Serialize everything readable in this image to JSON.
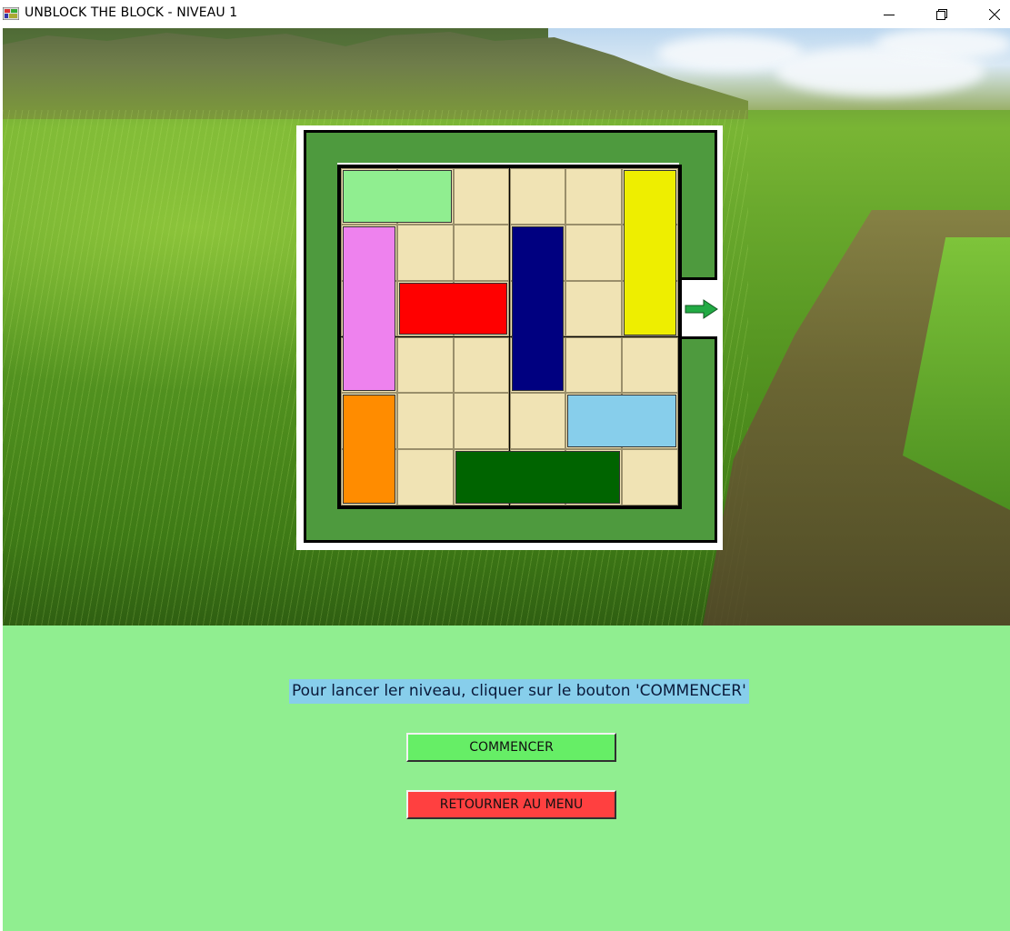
{
  "window": {
    "title": "UNBLOCK THE BLOCK - NIVEAU 1",
    "controls": [
      "minimize-icon",
      "restore-icon",
      "close-icon"
    ]
  },
  "board": {
    "rows": 6,
    "cols": 6,
    "exit_row": 2,
    "exit_side": "right",
    "exit_arrow_color": "#22aa44",
    "border_color": "#4e9a3e",
    "cell_color": "#f0e3b4",
    "blocks": [
      {
        "id": "light-green-block",
        "color": "#90ee90",
        "row": 0,
        "col": 0,
        "length": 2,
        "orientation": "horizontal"
      },
      {
        "id": "yellow-block",
        "color": "#eeee00",
        "row": 0,
        "col": 5,
        "length": 3,
        "orientation": "vertical"
      },
      {
        "id": "violet-block",
        "color": "#ee82ee",
        "row": 1,
        "col": 0,
        "length": 3,
        "orientation": "vertical"
      },
      {
        "id": "navy-block",
        "color": "#000080",
        "row": 1,
        "col": 3,
        "length": 3,
        "orientation": "vertical"
      },
      {
        "id": "red-target-block",
        "color": "#ff0000",
        "row": 2,
        "col": 1,
        "length": 2,
        "orientation": "horizontal"
      },
      {
        "id": "orange-block",
        "color": "#ff8c00",
        "row": 4,
        "col": 0,
        "length": 2,
        "orientation": "vertical"
      },
      {
        "id": "sky-blue-block",
        "color": "#87ceeb",
        "row": 4,
        "col": 4,
        "length": 2,
        "orientation": "horizontal"
      },
      {
        "id": "dark-green-block",
        "color": "#006400",
        "row": 5,
        "col": 2,
        "length": 3,
        "orientation": "horizontal"
      }
    ]
  },
  "panel": {
    "instruction": "Pour lancer ler niveau, cliquer sur le bouton 'COMMENCER'",
    "start_label": "COMMENCER",
    "menu_label": "RETOURNER AU MENU",
    "background_color": "#90ee90",
    "start_color": "#66ee66",
    "menu_color": "#ff4040"
  }
}
